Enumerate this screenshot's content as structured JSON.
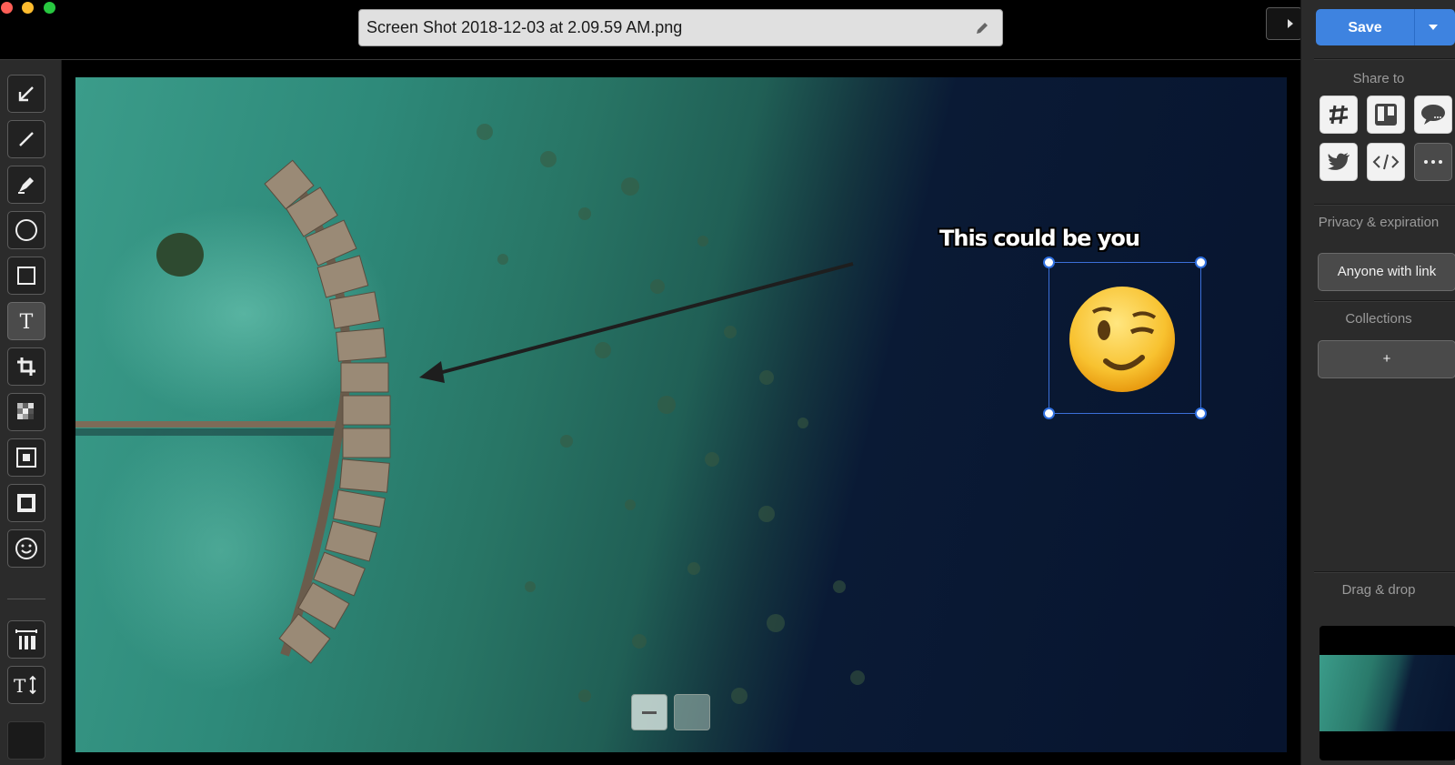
{
  "window": {
    "filename": "Screen Shot 2018-12-03 at 2.09.59 AM.png"
  },
  "toolbar": {
    "tools": [
      "arrow-icon",
      "line-icon",
      "highlighter-icon",
      "ellipse-icon",
      "rectangle-icon",
      "text-icon",
      "crop-icon",
      "pixelate-icon",
      "spotlight-icon",
      "blur-icon",
      "emoji-icon",
      "line-width-icon",
      "font-size-icon"
    ],
    "active_tool": "text-icon",
    "color": "#1a1a1a"
  },
  "annotation": {
    "text": "This could be you",
    "emoji": "winking-face-icon"
  },
  "sidebar": {
    "save_label": "Save",
    "share_to_label": "Share to",
    "share_targets": [
      "slack-icon",
      "trello-icon",
      "chat-icon",
      "twitter-icon",
      "embed-code-icon",
      "more-icon"
    ],
    "privacy_label": "Privacy & expiration",
    "privacy_value": "Anyone with link",
    "collections_label": "Collections",
    "add_collection_label": "+",
    "drag_drop_label": "Drag & drop"
  },
  "colors": {
    "accent": "#3e83e0",
    "selection": "#2f6fe0"
  }
}
